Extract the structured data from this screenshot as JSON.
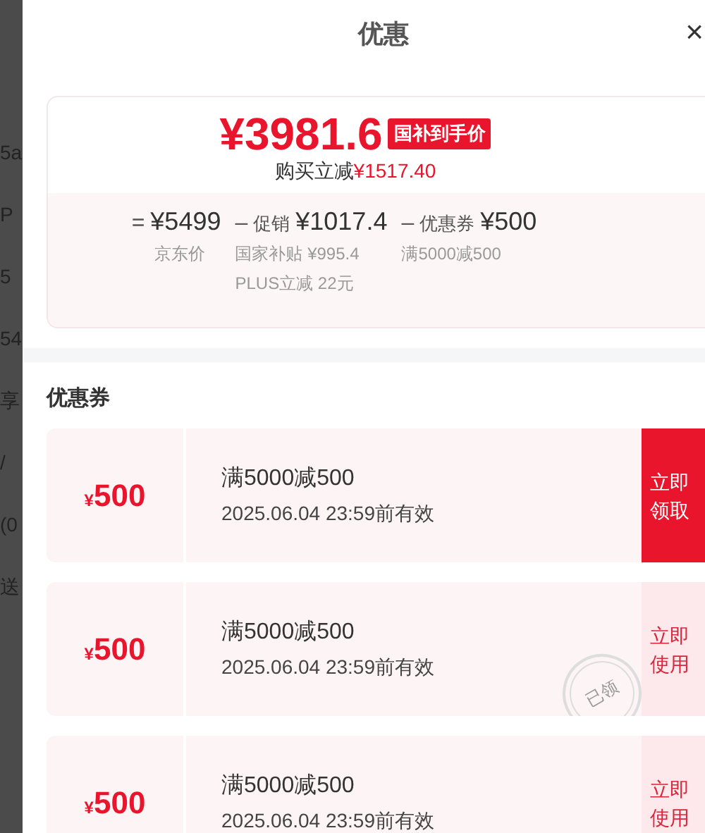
{
  "background_fragments": [
    "5a",
    "P",
    "5",
    "54",
    "享",
    "/",
    "(0",
    "送"
  ],
  "sheet": {
    "title": "优惠",
    "close": "×"
  },
  "summary": {
    "price": "¥3981.6",
    "price_badge": "国补到手价",
    "saving_label": "购买立减",
    "saving_amount": "¥1517.40",
    "breakdown": [
      {
        "operator": "=",
        "amount": "¥5499",
        "details": [
          "京东价"
        ]
      },
      {
        "operator": "–",
        "label": "促销",
        "amount": "¥1017.4",
        "details": [
          "国家补贴 ¥995.4",
          "PLUS立减 22元"
        ]
      },
      {
        "operator": "–",
        "label": "优惠券",
        "amount": "¥500",
        "details": [
          "满5000减500"
        ]
      }
    ]
  },
  "coupons_section": {
    "title": "优惠券",
    "coupons": [
      {
        "currency": "¥",
        "amount": "500",
        "condition": "满5000减500",
        "validity": "2025.06.04 23:59前有效",
        "claimed": false,
        "action": "立即领取"
      },
      {
        "currency": "¥",
        "amount": "500",
        "condition": "满5000减500",
        "validity": "2025.06.04 23:59前有效",
        "claimed": true,
        "stamp": "已领",
        "action": "立即使用"
      },
      {
        "currency": "¥",
        "amount": "500",
        "condition": "满5000减500",
        "validity": "2025.06.04 23:59前有效",
        "claimed": true,
        "action": "立即使用"
      }
    ]
  }
}
